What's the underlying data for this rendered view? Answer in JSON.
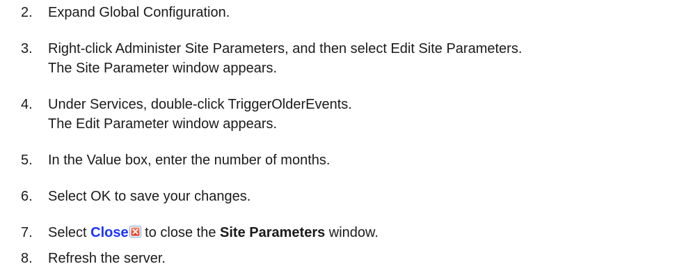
{
  "steps": [
    {
      "number": "2.",
      "text": "Expand Global Configuration."
    },
    {
      "number": "3.",
      "line1": "Right-click Administer Site Parameters, and then select Edit Site Parameters.",
      "line2": "The Site Parameter window appears."
    },
    {
      "number": "4.",
      "line1": "Under Services, double-click TriggerOlderEvents.",
      "line2": "The Edit Parameter window appears."
    },
    {
      "number": "5.",
      "text": "In the Value box, enter the number of months."
    },
    {
      "number": "6.",
      "text": "Select OK to save your changes."
    },
    {
      "number": "7.",
      "prefix": "Select ",
      "link": "Close",
      "middle": " to close the ",
      "bold": "Site Parameters",
      "suffix": " window.",
      "icon": "close-x-icon"
    },
    {
      "number": "8.",
      "text": "Refresh the server."
    }
  ],
  "colors": {
    "text": "#1a1a1a",
    "link": "#1a33ff",
    "icon_red": "#e04a2a"
  }
}
